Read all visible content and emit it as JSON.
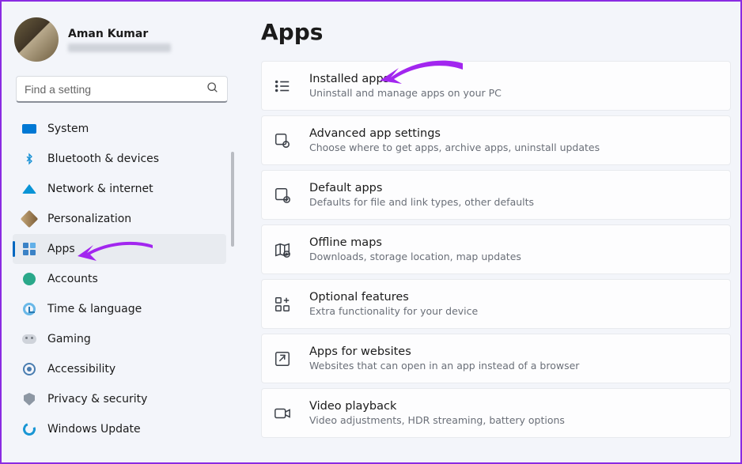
{
  "user": {
    "name": "Aman Kumar"
  },
  "search": {
    "placeholder": "Find a setting"
  },
  "sidebar": {
    "items": [
      {
        "id": "system",
        "label": "System"
      },
      {
        "id": "bluetooth",
        "label": "Bluetooth & devices"
      },
      {
        "id": "network",
        "label": "Network & internet"
      },
      {
        "id": "personalization",
        "label": "Personalization"
      },
      {
        "id": "apps",
        "label": "Apps",
        "active": true
      },
      {
        "id": "accounts",
        "label": "Accounts"
      },
      {
        "id": "time",
        "label": "Time & language"
      },
      {
        "id": "gaming",
        "label": "Gaming"
      },
      {
        "id": "accessibility",
        "label": "Accessibility"
      },
      {
        "id": "privacy",
        "label": "Privacy & security"
      },
      {
        "id": "update",
        "label": "Windows Update"
      }
    ]
  },
  "page": {
    "title": "Apps"
  },
  "cards": [
    {
      "id": "installed",
      "icon": "list",
      "title": "Installed apps",
      "desc": "Uninstall and manage apps on your PC"
    },
    {
      "id": "advanced",
      "icon": "gear-app",
      "title": "Advanced app settings",
      "desc": "Choose where to get apps, archive apps, uninstall updates"
    },
    {
      "id": "defaults",
      "icon": "default",
      "title": "Default apps",
      "desc": "Defaults for file and link types, other defaults"
    },
    {
      "id": "maps",
      "icon": "map",
      "title": "Offline maps",
      "desc": "Downloads, storage location, map updates"
    },
    {
      "id": "optional",
      "icon": "plus",
      "title": "Optional features",
      "desc": "Extra functionality for your device"
    },
    {
      "id": "websites",
      "icon": "link",
      "title": "Apps for websites",
      "desc": "Websites that can open in an app instead of a browser"
    },
    {
      "id": "video",
      "icon": "video",
      "title": "Video playback",
      "desc": "Video adjustments, HDR streaming, battery options"
    }
  ],
  "annotations": {
    "note": "Two purple arrow annotations point at the Apps sidebar item and the Installed apps card (instructional overlay, not part of the OS UI)."
  }
}
